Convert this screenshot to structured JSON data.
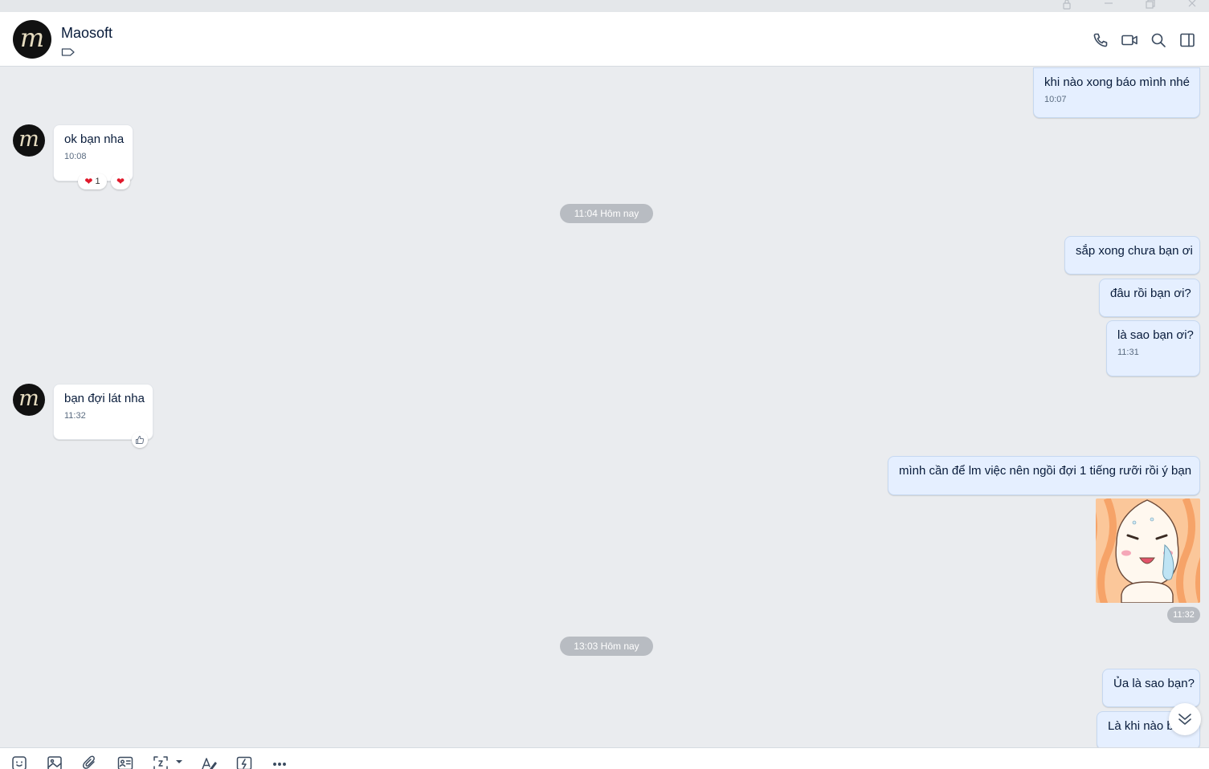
{
  "window": {
    "controls": [
      "lock-icon",
      "minimize-icon",
      "restore-icon",
      "close-icon"
    ]
  },
  "header": {
    "contact_name": "Maosoft",
    "avatar_letter": "m",
    "actions": [
      "phone-icon",
      "video-call-icon",
      "search-icon",
      "side-panel-icon"
    ]
  },
  "messages": [
    {
      "dir": "out",
      "text": "khi nào xong báo mình nhé",
      "time": "10:07"
    },
    {
      "dir": "in",
      "text": "ok bạn nha",
      "time": "10:08",
      "reaction_count": "1"
    },
    {
      "dir": "divider",
      "text": "11:04 Hôm nay"
    },
    {
      "dir": "out",
      "text": "sắp xong chưa bạn ơi"
    },
    {
      "dir": "out",
      "text": "đâu rồi bạn ơi?"
    },
    {
      "dir": "out",
      "text": "là sao bạn ơi?",
      "time": "11:31"
    },
    {
      "dir": "in",
      "text": "bạn đợi lát nha",
      "time": "11:32"
    },
    {
      "dir": "out",
      "text": "mình cần để lm việc nên ngồi đợi 1 tiếng rưỡi rồi ý bạn"
    },
    {
      "dir": "sticker",
      "time": "11:32"
    },
    {
      "dir": "divider",
      "text": "13:03 Hôm nay"
    },
    {
      "dir": "out",
      "text": "Ủa là sao bạn?"
    },
    {
      "dir": "out",
      "text": "Là khi nào bạn?"
    }
  ],
  "toolbar": {
    "tools": [
      "sticker-icon",
      "image-icon",
      "attach-icon",
      "contact-card-icon",
      "screenshot-icon",
      "format-text-icon",
      "quick-message-icon",
      "more-icon"
    ]
  },
  "colors": {
    "chat_bg": "#eaecef",
    "outgoing_bubble": "#e5efff",
    "incoming_bubble": "#ffffff",
    "heart": "#e0182a",
    "divider_pill": "#b8bcc2"
  }
}
